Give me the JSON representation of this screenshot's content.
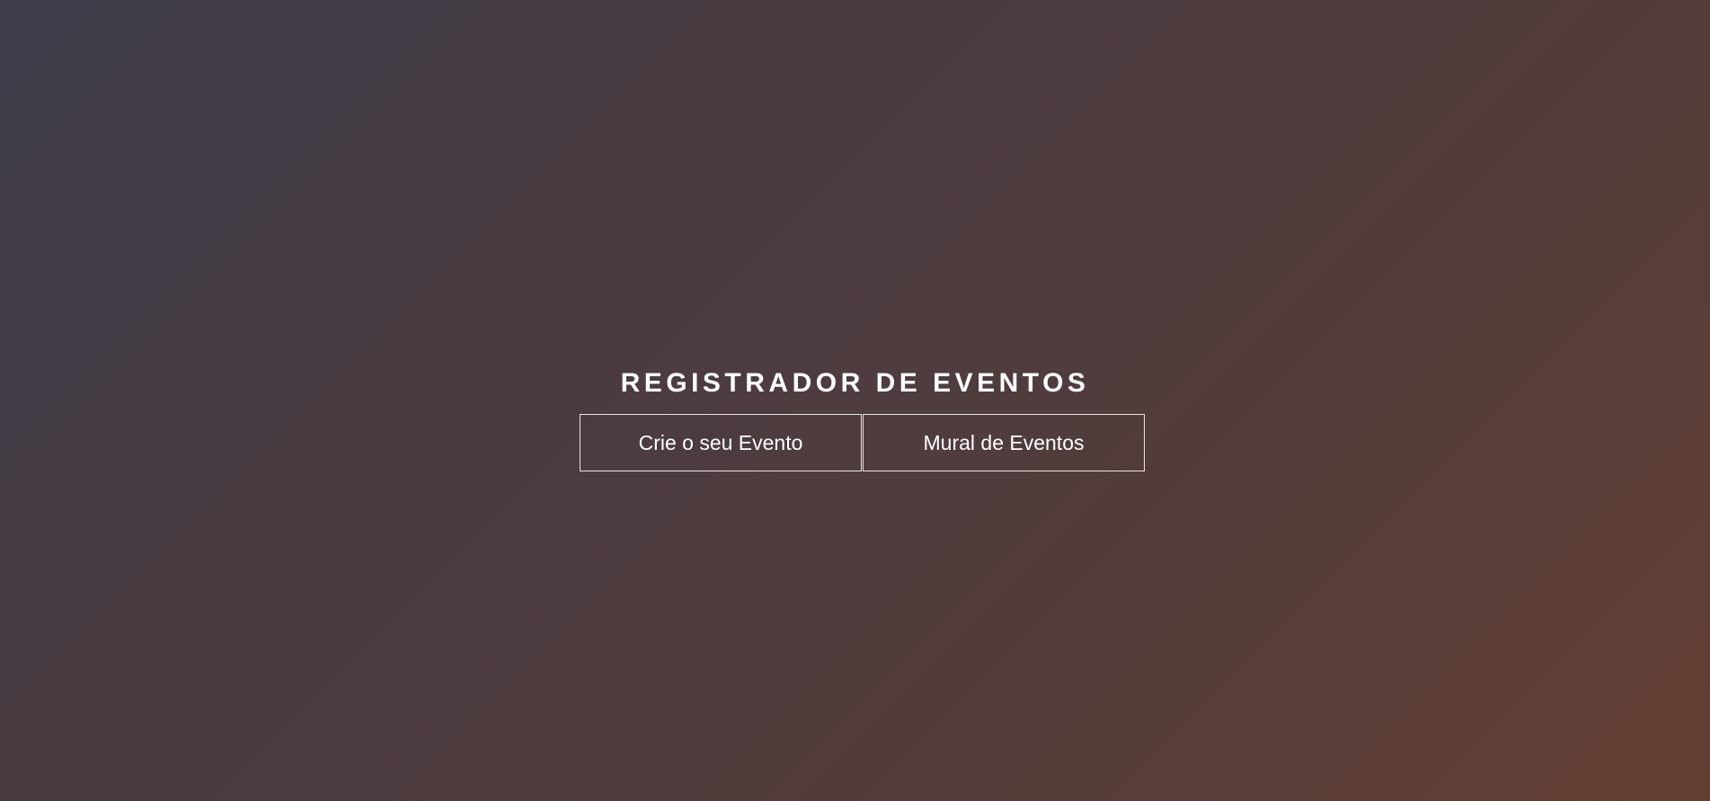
{
  "hero": {
    "title": "REGISTRADOR DE EVENTOS",
    "buttons": [
      {
        "label": "Crie o seu Evento"
      },
      {
        "label": "Mural de Eventos"
      }
    ]
  },
  "colors": {
    "background_start": "#3e3d4a",
    "background_end": "#633f33",
    "text": "#ffffff",
    "button_border": "#e8e4e4"
  }
}
